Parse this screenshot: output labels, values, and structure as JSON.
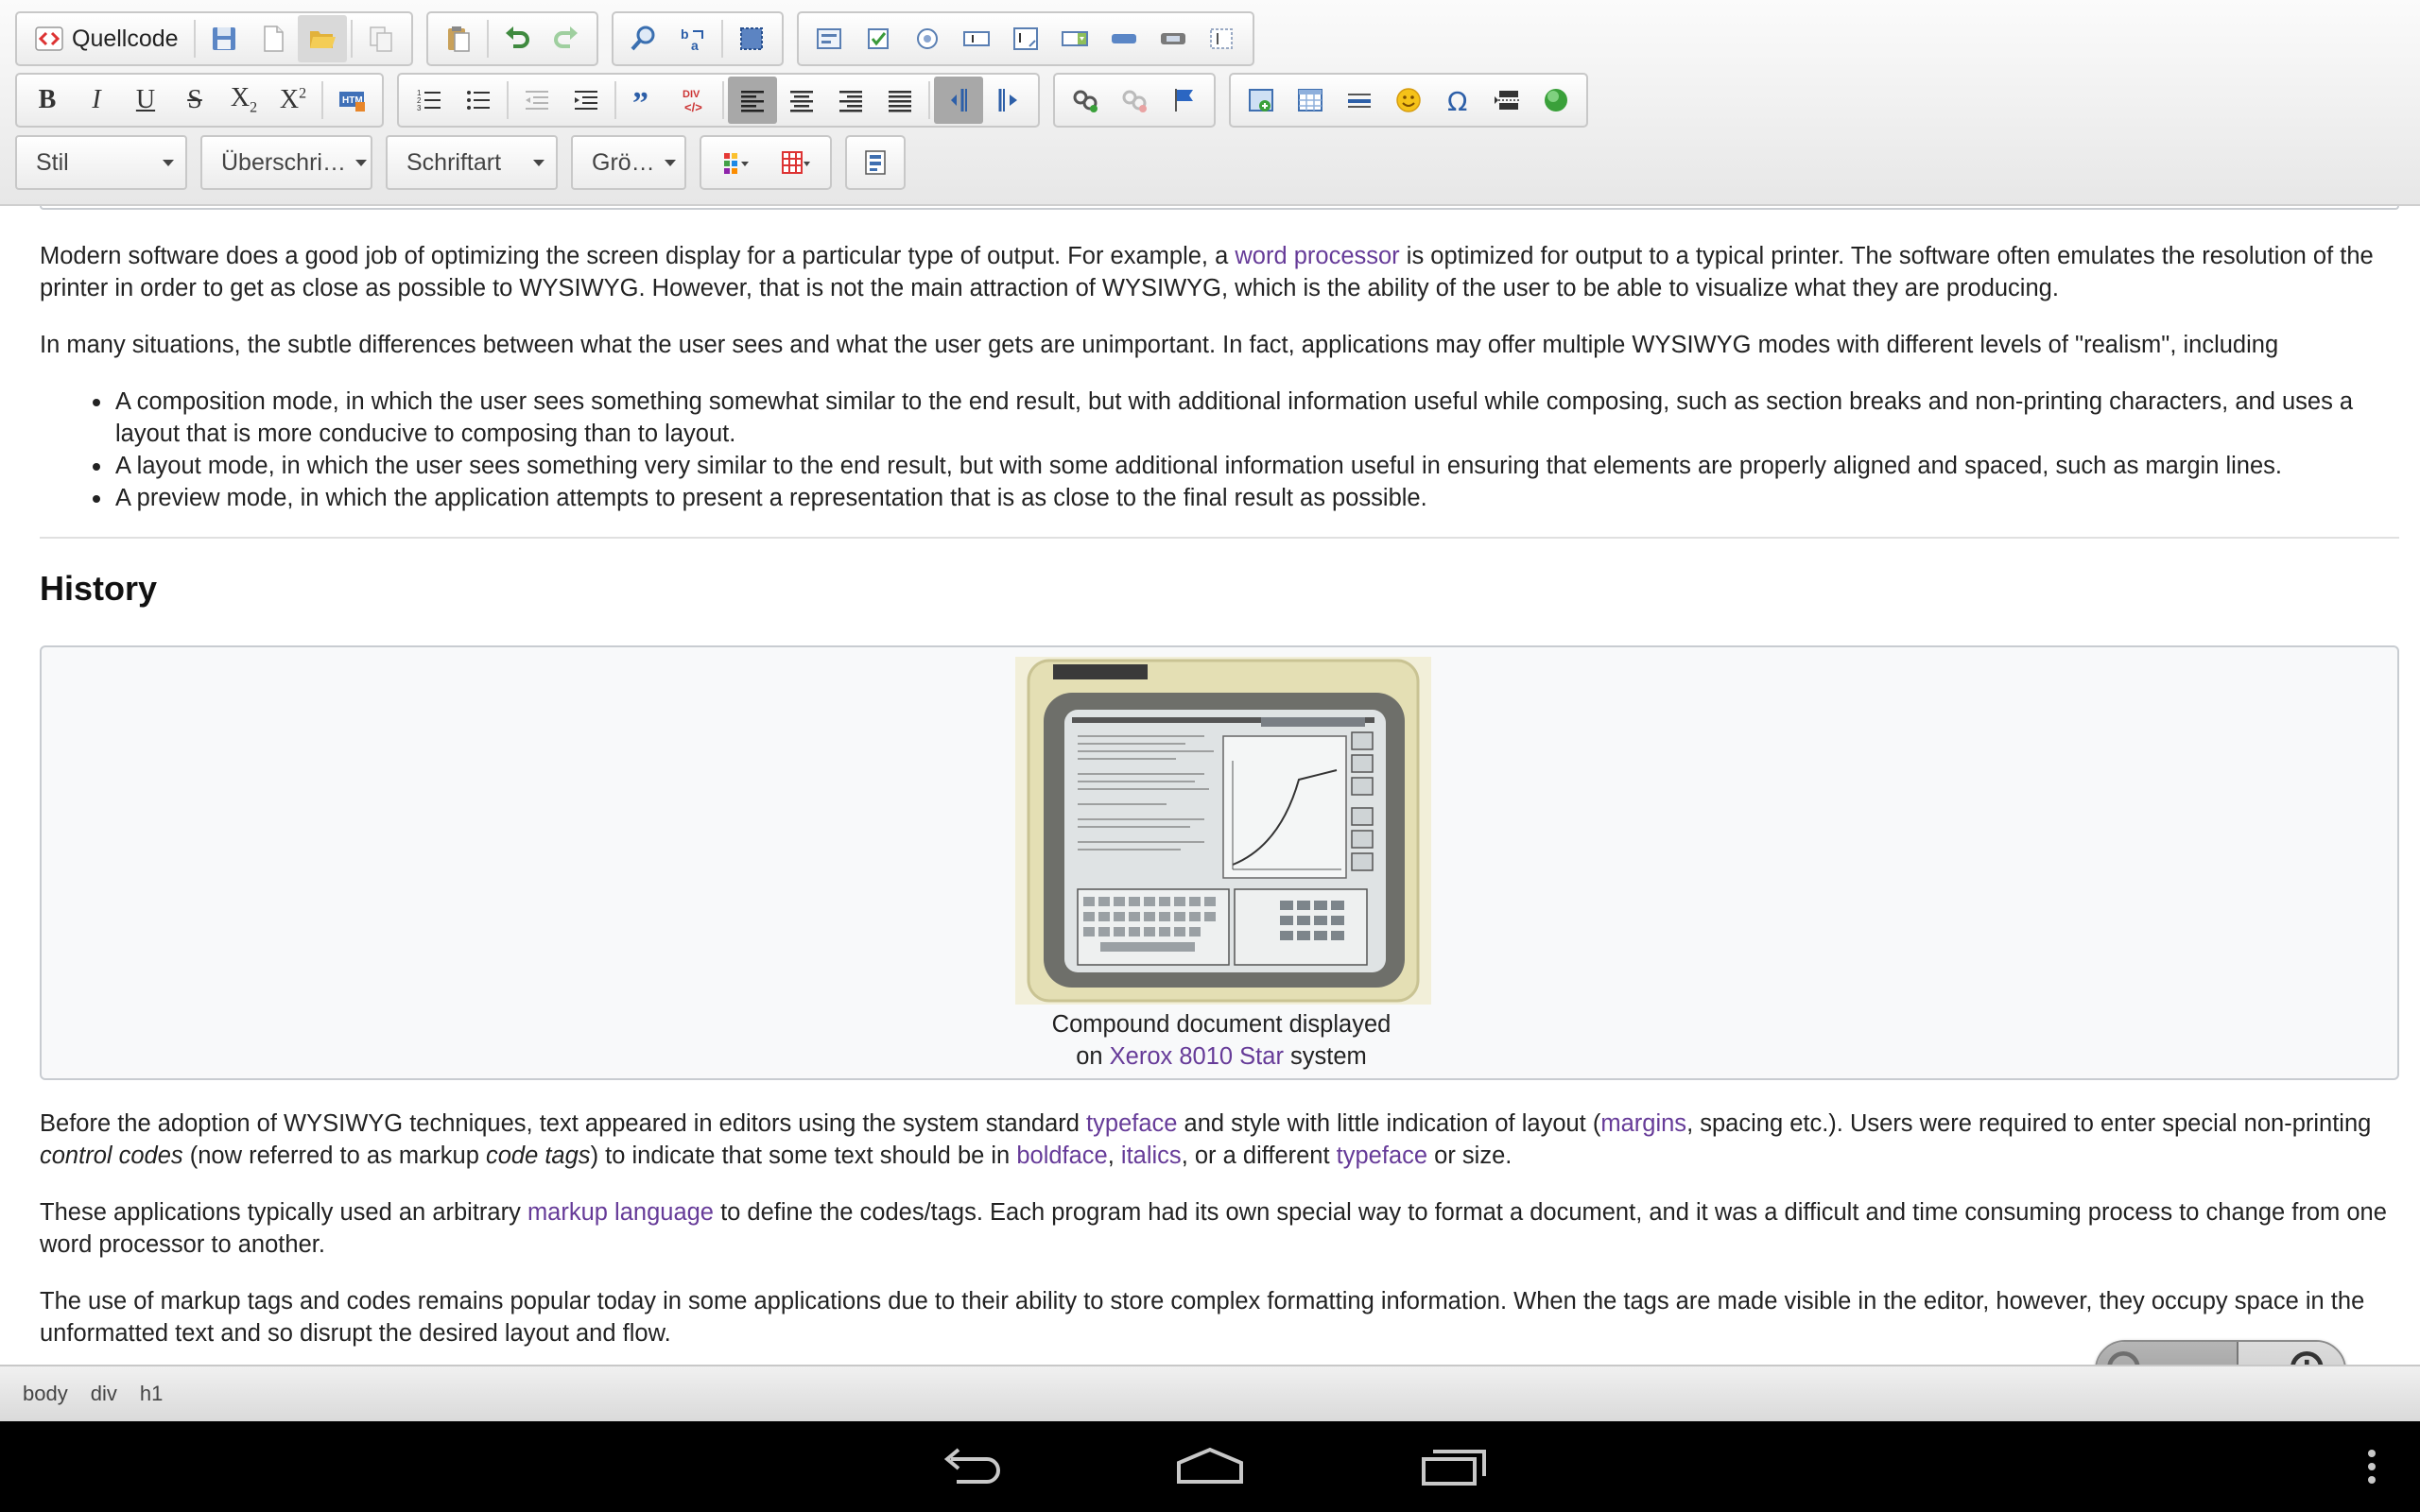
{
  "toolbar": {
    "source_label": "Quellcode",
    "style_combo": "Stil",
    "heading_combo": "Überschri…",
    "font_combo": "Schriftart",
    "size_combo": "Grö…"
  },
  "content": {
    "p1": [
      {
        "t": "Modern software does a good job of optimizing the screen display for a particular type of output. For example, a "
      },
      {
        "t": "word processor",
        "link": true
      },
      {
        "t": " is optimized for output to a typical printer. The software often emulates the resolution of the printer in order to get as close as possible to WYSIWYG. However, that is not the main attraction of WYSIWYG, which is the ability of the user to be able to visualize what they are producing."
      }
    ],
    "p2": "In many situations, the subtle differences between what the user sees and what the user gets are unimportant. In fact, applications may offer multiple WYSIWYG modes with different levels of \"realism\", including",
    "bullets": [
      "A composition mode, in which the user sees something somewhat similar to the end result, but with additional information useful while composing, such as section breaks and non-printing characters, and uses a layout that is more conducive to composing than to layout.",
      "A layout mode, in which the user sees something very similar to the end result, but with some additional information useful in ensuring that elements are properly aligned and spaced, such as margin lines.",
      "A preview mode, in which the application attempts to present a representation that is as close to the final result as possible."
    ],
    "history_heading": "History",
    "caption_line1": "Compound document displayed",
    "caption_pre": "on ",
    "caption_link": "Xerox 8010 Star",
    "caption_post": " system",
    "p3": [
      {
        "t": "Before the adoption of WYSIWYG techniques, text appeared in editors using the system standard "
      },
      {
        "t": "typeface",
        "link": true
      },
      {
        "t": " and style with little indication of layout ("
      },
      {
        "t": "margins",
        "link": true
      },
      {
        "t": ", spacing etc.). Users were required to enter special non-printing "
      },
      {
        "t": "control codes",
        "italic": true
      },
      {
        "t": " (now referred to as markup "
      },
      {
        "t": "code tags",
        "italic": true
      },
      {
        "t": ") to indicate that some text should be in "
      },
      {
        "t": "boldface",
        "link": true
      },
      {
        "t": ", "
      },
      {
        "t": "italics",
        "link": true
      },
      {
        "t": ", or a different "
      },
      {
        "t": "typeface",
        "link": true
      },
      {
        "t": " or size."
      }
    ],
    "p4": [
      {
        "t": "These applications typically used an arbitrary "
      },
      {
        "t": "markup language",
        "link": true
      },
      {
        "t": " to define the codes/tags. Each program had its own special way to format a document, and it was a difficult and time consuming process to change from one word processor to another."
      }
    ],
    "p5": "The use of markup tags and codes remains popular today in some applications due to their ability to store complex formatting information. When the tags are made visible in the editor, however, they occupy space in the unformatted text and so disrupt the desired layout and flow."
  },
  "pathbar": [
    "body",
    "div",
    "h1"
  ],
  "colors": {
    "link": "#663b98",
    "nav_bg": "#000000"
  }
}
